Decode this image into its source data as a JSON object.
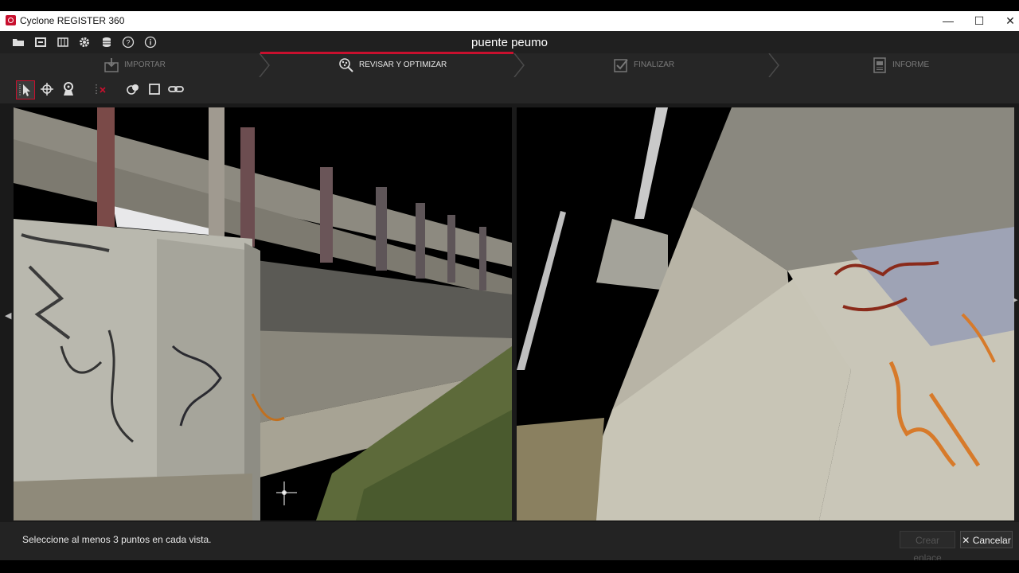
{
  "window": {
    "app_title": "Cyclone REGISTER 360",
    "minimize": "—",
    "maximize": "☐",
    "close": "✕"
  },
  "appbar": {
    "project_name": "puente peumo",
    "icons": [
      "open-folder-icon",
      "archive-icon",
      "layers-icon",
      "gear-icon",
      "database-icon",
      "help-icon",
      "info-icon"
    ]
  },
  "workflow": {
    "steps": [
      {
        "label": "IMPORTAR",
        "icon": "import-icon",
        "active": false
      },
      {
        "label": "REVISAR Y OPTIMIZAR",
        "icon": "review-icon",
        "active": true
      },
      {
        "label": "FINALIZAR",
        "icon": "finalize-icon",
        "active": false
      },
      {
        "label": "INFORME",
        "icon": "report-icon",
        "active": false
      }
    ],
    "active_color": "#c8102e"
  },
  "toolbar": {
    "tools": [
      "select-pointer-icon",
      "target-crosshair-icon",
      "station-icon",
      "clear-points-icon",
      "merge-icon",
      "box-icon",
      "link-icon"
    ]
  },
  "status": {
    "message": "Seleccione al menos 3 puntos en cada vista.",
    "create_link_label": "Crear enlace",
    "cancel_label": "Cancelar",
    "cancel_icon": "✕"
  }
}
